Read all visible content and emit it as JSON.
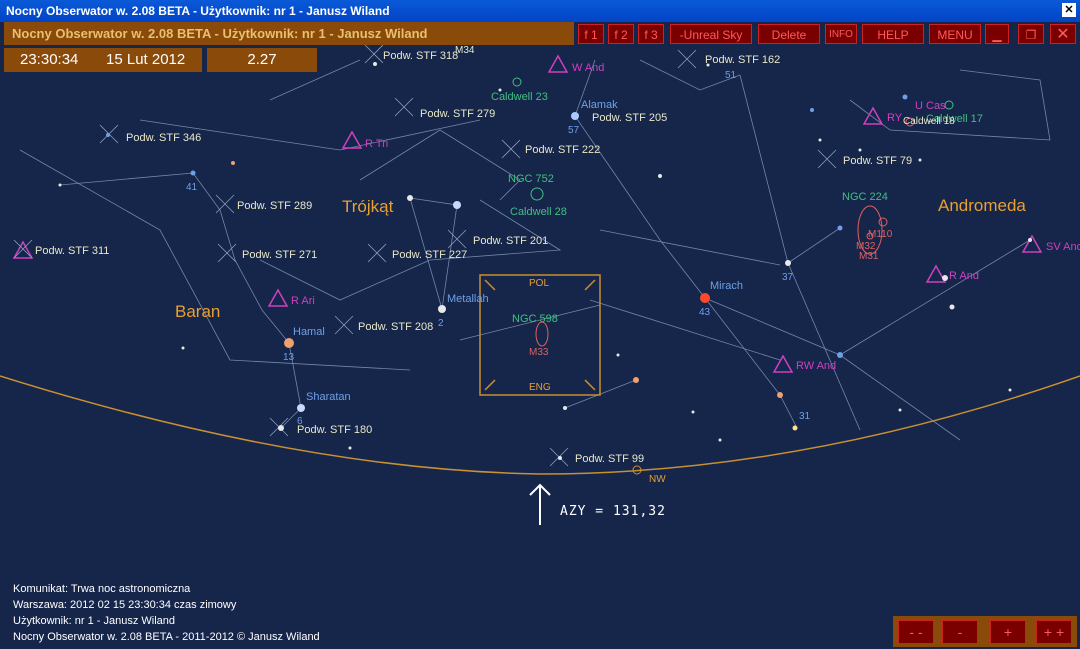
{
  "window": {
    "title": "Nocny Obserwator w. 2.08 BETA -  Użytkownik:  nr 1 - Janusz Wiland",
    "header_text": "Nocny Obserwator w. 2.08 BETA -  Użytkownik:  nr 1 - Janusz Wiland"
  },
  "clock": {
    "time": "23:30:34",
    "date": "15 Lut 2012",
    "value": "2.27"
  },
  "toolbar": {
    "buttons": [
      "f 1",
      "f 2",
      "f 3",
      "-Unreal Sky",
      "Delete",
      "INFO",
      "HELP",
      "MENU"
    ]
  },
  "zoom": {
    "buttons": [
      "- -",
      "-",
      "+",
      "+ +"
    ]
  },
  "sky": {
    "constellations": [
      "Trójkąt",
      "Baran",
      "Andromeda"
    ],
    "labels": {
      "l1": "Podw. STF 318",
      "l2": "M34",
      "l3": "W And",
      "l4": "Podw. STF 162",
      "l5": "Caldwell  23",
      "l6": "Alamak",
      "l7": "Podw. STF 205",
      "l8": "Podw. STF 279",
      "l9": "Podw. STF 346",
      "l10": "R Tri",
      "l11": "Podw. STF 222",
      "l12": "Podw. STF 79",
      "l13": "NGC  752",
      "l14": "Caldwell  28",
      "l15": "NGC  224",
      "l16": "Podw. STF 289",
      "l17": "Podw. STF 201",
      "l18": "Podw. STF 311",
      "l19": "Podw. STF 271",
      "l20": "Podw. STF 227",
      "l21": "Metallah",
      "l22": "Mirach",
      "l23": "R Ari",
      "l24": "Hamal",
      "l25": "Podw. STF 208",
      "l26": "NGC  598",
      "l27": "M33",
      "l28": "POL",
      "l29": "ENG",
      "l30": "RW And",
      "l31": "Sharatan",
      "l32": "Podw. STF 180",
      "l33": "Podw. STF 99",
      "l34": "NW",
      "l35": "R And",
      "l36": "SV And",
      "l37": "M110",
      "l38": "M32",
      "l39": "M31",
      "l40": "U Cas",
      "l41": "RY",
      "l42": "Caldwell 17",
      "l43": "Caldwell 18"
    },
    "numbers": {
      "n41": "41",
      "n57": "57",
      "n51": "51",
      "n2": "2",
      "n13": "13",
      "n43": "43",
      "n37": "37",
      "n31": "31",
      "n6": "6"
    }
  },
  "azimuth": "AZY = 131,32",
  "status": {
    "line1": "Komunikat: Trwa noc astronomiczna",
    "line2": "Warszawa:  2012 02 15  23:30:34 czas zimowy",
    "line3": "Użytkownik:  nr 1 - Janusz Wiland",
    "line4": "Nocny Obserwator w. 2.08 BETA - 2011-2012 © Janusz Wiland"
  },
  "colors": {
    "sky": "#16254a",
    "horizon": "#c89030",
    "panel": "#8a4a0a",
    "button": "#7a0000"
  }
}
